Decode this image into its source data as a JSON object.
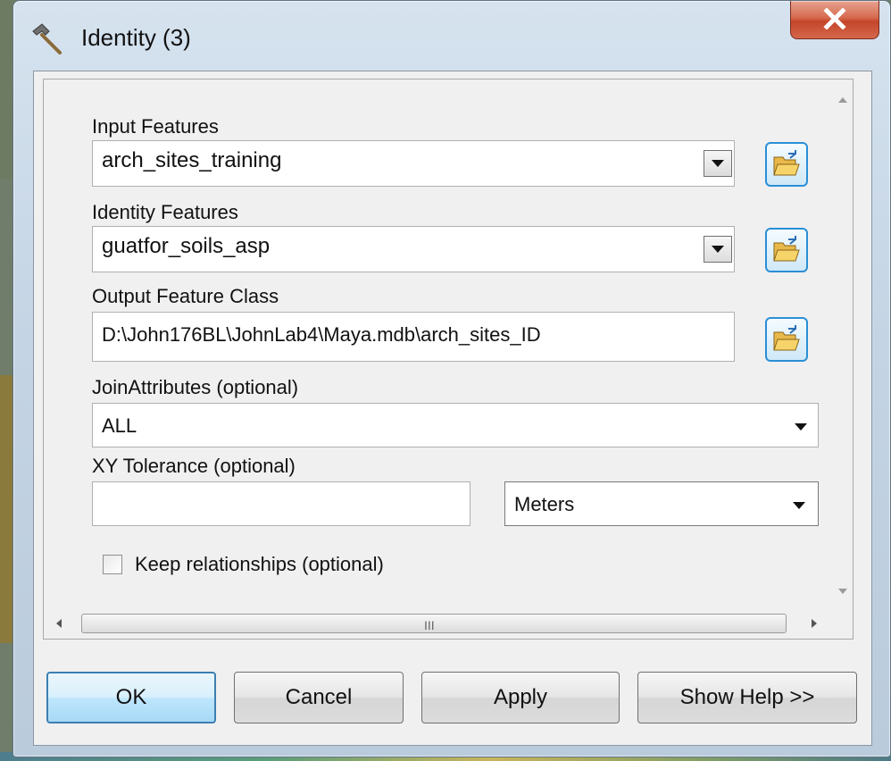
{
  "window": {
    "title": "Identity (3)",
    "close_icon": "close-x-icon",
    "title_icon": "hammer-icon",
    "colors": {
      "close": "#c4452a",
      "default_button": "#3c7fb1",
      "folder_accent": "#2a8fd6"
    }
  },
  "form": {
    "input_features": {
      "label": "Input Features",
      "value": "arch_sites_training"
    },
    "identity_features": {
      "label": "Identity Features",
      "value": "guatfor_soils_asp"
    },
    "output_feature_class": {
      "label": "Output Feature Class",
      "value": "D:\\John176BL\\JohnLab4\\Maya.mdb\\arch_sites_ID"
    },
    "join_attributes": {
      "label": "JoinAttributes (optional)",
      "value": "ALL"
    },
    "xy_tolerance": {
      "label": "XY Tolerance (optional)",
      "value": "",
      "unit": "Meters"
    },
    "keep_relationships": {
      "label": "Keep relationships (optional)",
      "checked": false
    }
  },
  "scroll": {
    "grip": "III"
  },
  "buttons": {
    "ok": "OK",
    "cancel": "Cancel",
    "apply": "Apply",
    "help": "Show Help >>"
  }
}
